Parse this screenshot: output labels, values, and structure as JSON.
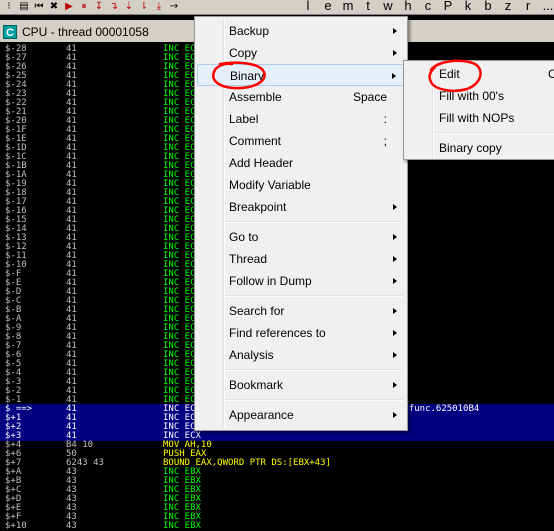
{
  "toolbar": {
    "buttons": [
      {
        "icon": "dotted-icon",
        "glyph": "⁝",
        "red": false
      },
      {
        "icon": "open-file-icon",
        "glyph": "▤",
        "red": false
      },
      {
        "icon": "restart-icon",
        "glyph": "⏮",
        "red": false
      },
      {
        "icon": "close-icon",
        "glyph": "✖",
        "red": false
      },
      {
        "icon": "run-icon",
        "glyph": "▶",
        "red": true
      },
      {
        "icon": "pause-icon",
        "glyph": "⏸",
        "red": true
      },
      {
        "icon": "step-into-icon",
        "glyph": "↧",
        "red": true
      },
      {
        "icon": "step-over-icon",
        "glyph": "↴",
        "red": true
      },
      {
        "icon": "trace-into-icon",
        "glyph": "⇣",
        "red": true
      },
      {
        "icon": "trace-over-icon",
        "glyph": "⇂",
        "red": true
      },
      {
        "icon": "execute-till-return-icon",
        "glyph": "⤓",
        "red": true
      },
      {
        "icon": "goto-icon",
        "glyph": "→",
        "red": false
      }
    ],
    "letters": [
      "l",
      "e",
      "m",
      "t",
      "w",
      "h",
      "c",
      "P",
      "k",
      "b",
      "z",
      "r",
      "..."
    ]
  },
  "window": {
    "icon_letter": "C",
    "title": "CPU - thread 00001058"
  },
  "disasm": {
    "rows": [
      {
        "addr": "$-28",
        "hex": "41",
        "cmd": "INC ECX"
      },
      {
        "addr": "$-27",
        "hex": "41",
        "cmd": "INC ECX"
      },
      {
        "addr": "$-26",
        "hex": "41",
        "cmd": "INC ECX"
      },
      {
        "addr": "$-25",
        "hex": "41",
        "cmd": "INC ECX"
      },
      {
        "addr": "$-24",
        "hex": "41",
        "cmd": "INC ECX"
      },
      {
        "addr": "$-23",
        "hex": "41",
        "cmd": "INC ECX"
      },
      {
        "addr": "$-22",
        "hex": "41",
        "cmd": "INC ECX"
      },
      {
        "addr": "$-21",
        "hex": "41",
        "cmd": "INC ECX"
      },
      {
        "addr": "$-20",
        "hex": "41",
        "cmd": "INC ECX"
      },
      {
        "addr": "$-1F",
        "hex": "41",
        "cmd": "INC ECX"
      },
      {
        "addr": "$-1E",
        "hex": "41",
        "cmd": "INC ECX"
      },
      {
        "addr": "$-1D",
        "hex": "41",
        "cmd": "INC ECX"
      },
      {
        "addr": "$-1C",
        "hex": "41",
        "cmd": "INC ECX"
      },
      {
        "addr": "$-1B",
        "hex": "41",
        "cmd": "INC ECX"
      },
      {
        "addr": "$-1A",
        "hex": "41",
        "cmd": "INC ECX"
      },
      {
        "addr": "$-19",
        "hex": "41",
        "cmd": "INC ECX"
      },
      {
        "addr": "$-18",
        "hex": "41",
        "cmd": "INC ECX"
      },
      {
        "addr": "$-17",
        "hex": "41",
        "cmd": "INC ECX"
      },
      {
        "addr": "$-16",
        "hex": "41",
        "cmd": "INC ECX"
      },
      {
        "addr": "$-15",
        "hex": "41",
        "cmd": "INC ECX"
      },
      {
        "addr": "$-14",
        "hex": "41",
        "cmd": "INC ECX"
      },
      {
        "addr": "$-13",
        "hex": "41",
        "cmd": "INC ECX"
      },
      {
        "addr": "$-12",
        "hex": "41",
        "cmd": "INC ECX"
      },
      {
        "addr": "$-11",
        "hex": "41",
        "cmd": "INC ECX"
      },
      {
        "addr": "$-10",
        "hex": "41",
        "cmd": "INC ECX"
      },
      {
        "addr": "$-F",
        "hex": "41",
        "cmd": "INC ECX"
      },
      {
        "addr": "$-E",
        "hex": "41",
        "cmd": "INC ECX"
      },
      {
        "addr": "$-D",
        "hex": "41",
        "cmd": "INC ECX"
      },
      {
        "addr": "$-C",
        "hex": "41",
        "cmd": "INC ECX"
      },
      {
        "addr": "$-B",
        "hex": "41",
        "cmd": "INC ECX"
      },
      {
        "addr": "$-A",
        "hex": "41",
        "cmd": "INC ECX"
      },
      {
        "addr": "$-9",
        "hex": "41",
        "cmd": "INC ECX"
      },
      {
        "addr": "$-8",
        "hex": "41",
        "cmd": "INC ECX"
      },
      {
        "addr": "$-7",
        "hex": "41",
        "cmd": "INC ECX"
      },
      {
        "addr": "$-6",
        "hex": "41",
        "cmd": "INC ECX"
      },
      {
        "addr": "$-5",
        "hex": "41",
        "cmd": "INC ECX"
      },
      {
        "addr": "$-4",
        "hex": "41",
        "cmd": "INC ECX"
      },
      {
        "addr": "$-3",
        "hex": "41",
        "cmd": "INC ECX"
      },
      {
        "addr": "$-2",
        "hex": "41",
        "cmd": "INC ECX"
      },
      {
        "addr": "$-1",
        "hex": "41",
        "cmd": "INC ECX"
      },
      {
        "addr": "$ ==>",
        "hex": "41",
        "cmd": "INC ECX",
        "selected": true,
        "comment": "ssfunc.625010B4"
      },
      {
        "addr": "$+1",
        "hex": "41",
        "cmd": "INC ECX",
        "selected": true
      },
      {
        "addr": "$+2",
        "hex": "41",
        "cmd": "INC ECX",
        "selected": true
      },
      {
        "addr": "$+3",
        "hex": "41",
        "cmd": "INC ECX",
        "selected": true
      },
      {
        "addr": "$+4",
        "hex": "B4 10",
        "cmd": "MOV AH,10",
        "yellow": true
      },
      {
        "addr": "$+6",
        "hex": "50",
        "cmd": "PUSH EAX",
        "yellow": true
      },
      {
        "addr": "$+7",
        "hex": "6243 43",
        "cmd": "BOUND EAX,QWORD PTR DS:[EBX+43]",
        "yellow": true
      },
      {
        "addr": "$+A",
        "hex": "43",
        "cmd": "INC EBX"
      },
      {
        "addr": "$+B",
        "hex": "43",
        "cmd": "INC EBX"
      },
      {
        "addr": "$+C",
        "hex": "43",
        "cmd": "INC EBX"
      },
      {
        "addr": "$+D",
        "hex": "43",
        "cmd": "INC EBX"
      },
      {
        "addr": "$+E",
        "hex": "43",
        "cmd": "INC EBX"
      },
      {
        "addr": "$+F",
        "hex": "43",
        "cmd": "INC EBX"
      },
      {
        "addr": "$+10",
        "hex": "43",
        "cmd": "INC EBX"
      }
    ]
  },
  "context_menu": {
    "items": [
      {
        "label": "Backup",
        "submenu": true
      },
      {
        "label": "Copy",
        "submenu": true
      },
      {
        "label": "Binary",
        "submenu": true,
        "highlighted": true
      },
      {
        "label": "Assemble",
        "shortcut": "Space"
      },
      {
        "label": "Label",
        "shortcut": ":"
      },
      {
        "label": "Comment",
        "shortcut": ";"
      },
      {
        "label": "Add Header"
      },
      {
        "label": "Modify Variable"
      },
      {
        "label": "Breakpoint",
        "submenu": true
      },
      {
        "separator": true
      },
      {
        "label": "Go to",
        "submenu": true
      },
      {
        "label": "Thread",
        "submenu": true
      },
      {
        "label": "Follow in Dump",
        "submenu": true
      },
      {
        "separator": true
      },
      {
        "label": "Search for",
        "submenu": true
      },
      {
        "label": "Find references to",
        "submenu": true
      },
      {
        "label": "Analysis",
        "submenu": true
      },
      {
        "separator": true
      },
      {
        "label": "Bookmark",
        "submenu": true
      },
      {
        "separator": true
      },
      {
        "label": "Appearance",
        "submenu": true
      }
    ]
  },
  "binary_submenu": {
    "items": [
      {
        "label": "Edit",
        "shortcut": "C"
      },
      {
        "label": "Fill with 00's"
      },
      {
        "label": "Fill with NOPs"
      },
      {
        "separator": true
      },
      {
        "label": "Binary copy"
      }
    ]
  },
  "colors": {
    "annotation": "#ff0000",
    "code_green": "#00ff00",
    "code_yellow": "#ffff00",
    "selection": "#000080"
  }
}
